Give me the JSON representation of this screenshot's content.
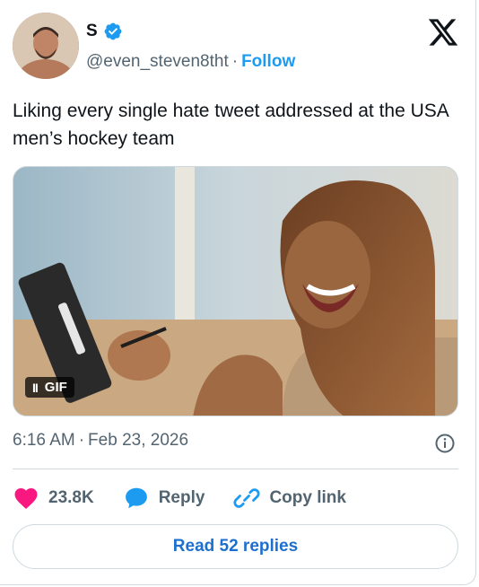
{
  "author": {
    "name": "S",
    "handle": "@even_steven8tht",
    "separator": "·",
    "follow_label": "Follow",
    "verified_icon": "verified-badge-icon",
    "verified_color": "#1d9bf0"
  },
  "brand_icon": "x-logo-icon",
  "tweet": {
    "text": "Liking every single hate tweet addressed at the USA men’s hockey team"
  },
  "media": {
    "type": "GIF",
    "badge_label": "GIF",
    "pause_glyph": "II"
  },
  "meta": {
    "time": "6:16 AM",
    "separator": "·",
    "date": "Feb 23, 2026",
    "info_icon": "info-icon"
  },
  "actions": {
    "like_count": "23.8K",
    "like_color": "#f91880",
    "reply_label": "Reply",
    "reply_color": "#1d9bf0",
    "copy_link_label": "Copy link",
    "copy_link_color": "#1d9bf0"
  },
  "read_replies_label": "Read 52 replies",
  "accent_color": "#1d9bf0"
}
